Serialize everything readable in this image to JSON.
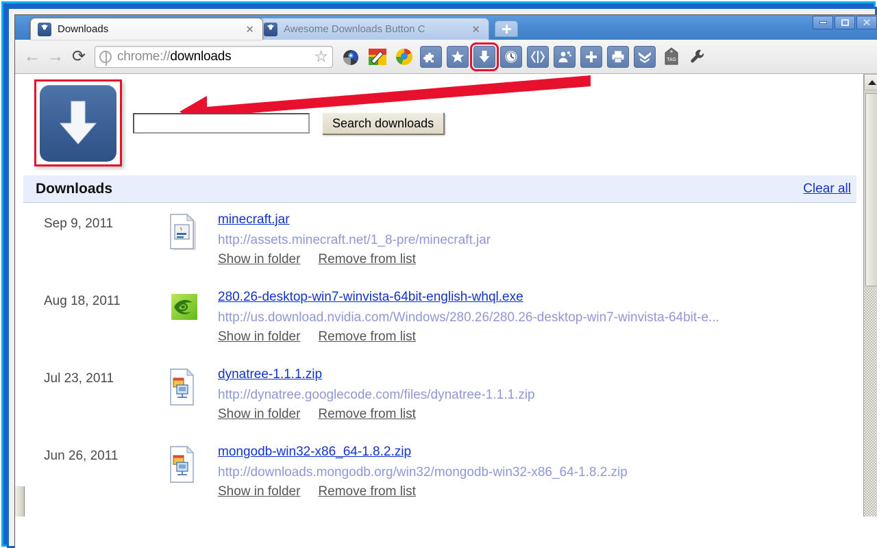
{
  "window": {
    "controls": {
      "minimize": "–",
      "maximize": "□",
      "close": "✕"
    }
  },
  "tabs": [
    {
      "title": "Downloads",
      "close": "✕",
      "favicon": "download-arrow-icon",
      "active": true
    },
    {
      "title": "Awesome Downloads Button C",
      "close": "✕",
      "favicon": "download-arrow-icon",
      "active": false
    }
  ],
  "new_tab_label": "✛",
  "toolbar": {
    "back": "←",
    "forward": "→",
    "reload": "⟳",
    "url_scheme": "chrome://",
    "url_rest": "downloads",
    "url_full": "chrome://downloads",
    "star": "☆",
    "extensions": [
      {
        "name": "globe-extension-icon",
        "tooltip": ""
      },
      {
        "name": "chrome-paint-extension-icon",
        "tooltip": ""
      },
      {
        "name": "colored-globe-extension-icon",
        "tooltip": ""
      },
      {
        "name": "puzzle-piece-extension-icon",
        "tooltip": ""
      },
      {
        "name": "star-extension-icon",
        "tooltip": ""
      },
      {
        "name": "downloads-button-extension-icon",
        "tooltip": "",
        "highlighted": true
      },
      {
        "name": "clock-history-extension-icon",
        "tooltip": ""
      },
      {
        "name": "code-brackets-extension-icon",
        "tooltip": ""
      },
      {
        "name": "person-add-extension-icon",
        "tooltip": ""
      },
      {
        "name": "plus-extension-icon",
        "tooltip": ""
      },
      {
        "name": "printer-extension-icon",
        "tooltip": ""
      },
      {
        "name": "chevrons-down-extension-icon",
        "tooltip": ""
      },
      {
        "name": "tag-extension-icon",
        "label": "TAG"
      },
      {
        "name": "wrench-menu-icon",
        "tooltip": ""
      }
    ]
  },
  "page": {
    "big_download_button": "download-arrow-large-icon",
    "search": {
      "value": "",
      "placeholder": "",
      "button_label": "Search downloads"
    },
    "downloads_header": {
      "title": "Downloads",
      "clear_all": "Clear all"
    },
    "action_labels": {
      "show_in_folder": "Show in folder",
      "remove_from_list": "Remove from list"
    },
    "downloads": [
      {
        "date": "Sep 9, 2011",
        "icon": "java-jar-file-icon",
        "filename": "minecraft.jar",
        "url": "http://assets.minecraft.net/1_8-pre/minecraft.jar",
        "show_in_folder": "Show in folder",
        "remove_from_list": "Remove from list"
      },
      {
        "date": "Aug 18, 2011",
        "icon": "nvidia-executable-icon",
        "filename": "280.26-desktop-win7-winvista-64bit-english-whql.exe",
        "url": "http://us.download.nvidia.com/Windows/280.26/280.26-desktop-win7-winvista-64bit-e...",
        "show_in_folder": "Show in folder",
        "remove_from_list": "Remove from list"
      },
      {
        "date": "Jul 23, 2011",
        "icon": "zip-archive-file-icon",
        "filename": "dynatree-1.1.1.zip",
        "url": "http://dynatree.googlecode.com/files/dynatree-1.1.1.zip",
        "show_in_folder": "Show in folder",
        "remove_from_list": "Remove from list"
      },
      {
        "date": "Jun 26, 2011",
        "icon": "zip-archive-file-icon",
        "filename": "mongodb-win32-x86_64-1.8.2.zip",
        "url": "http://downloads.mongodb.org/win32/mongodb-win32-x86_64-1.8.2.zip",
        "show_in_folder": "Show in folder",
        "remove_from_list": "Remove from list"
      }
    ]
  },
  "annotation": {
    "arrow_color": "#e8112d",
    "highlight_color": "#e8112d"
  }
}
